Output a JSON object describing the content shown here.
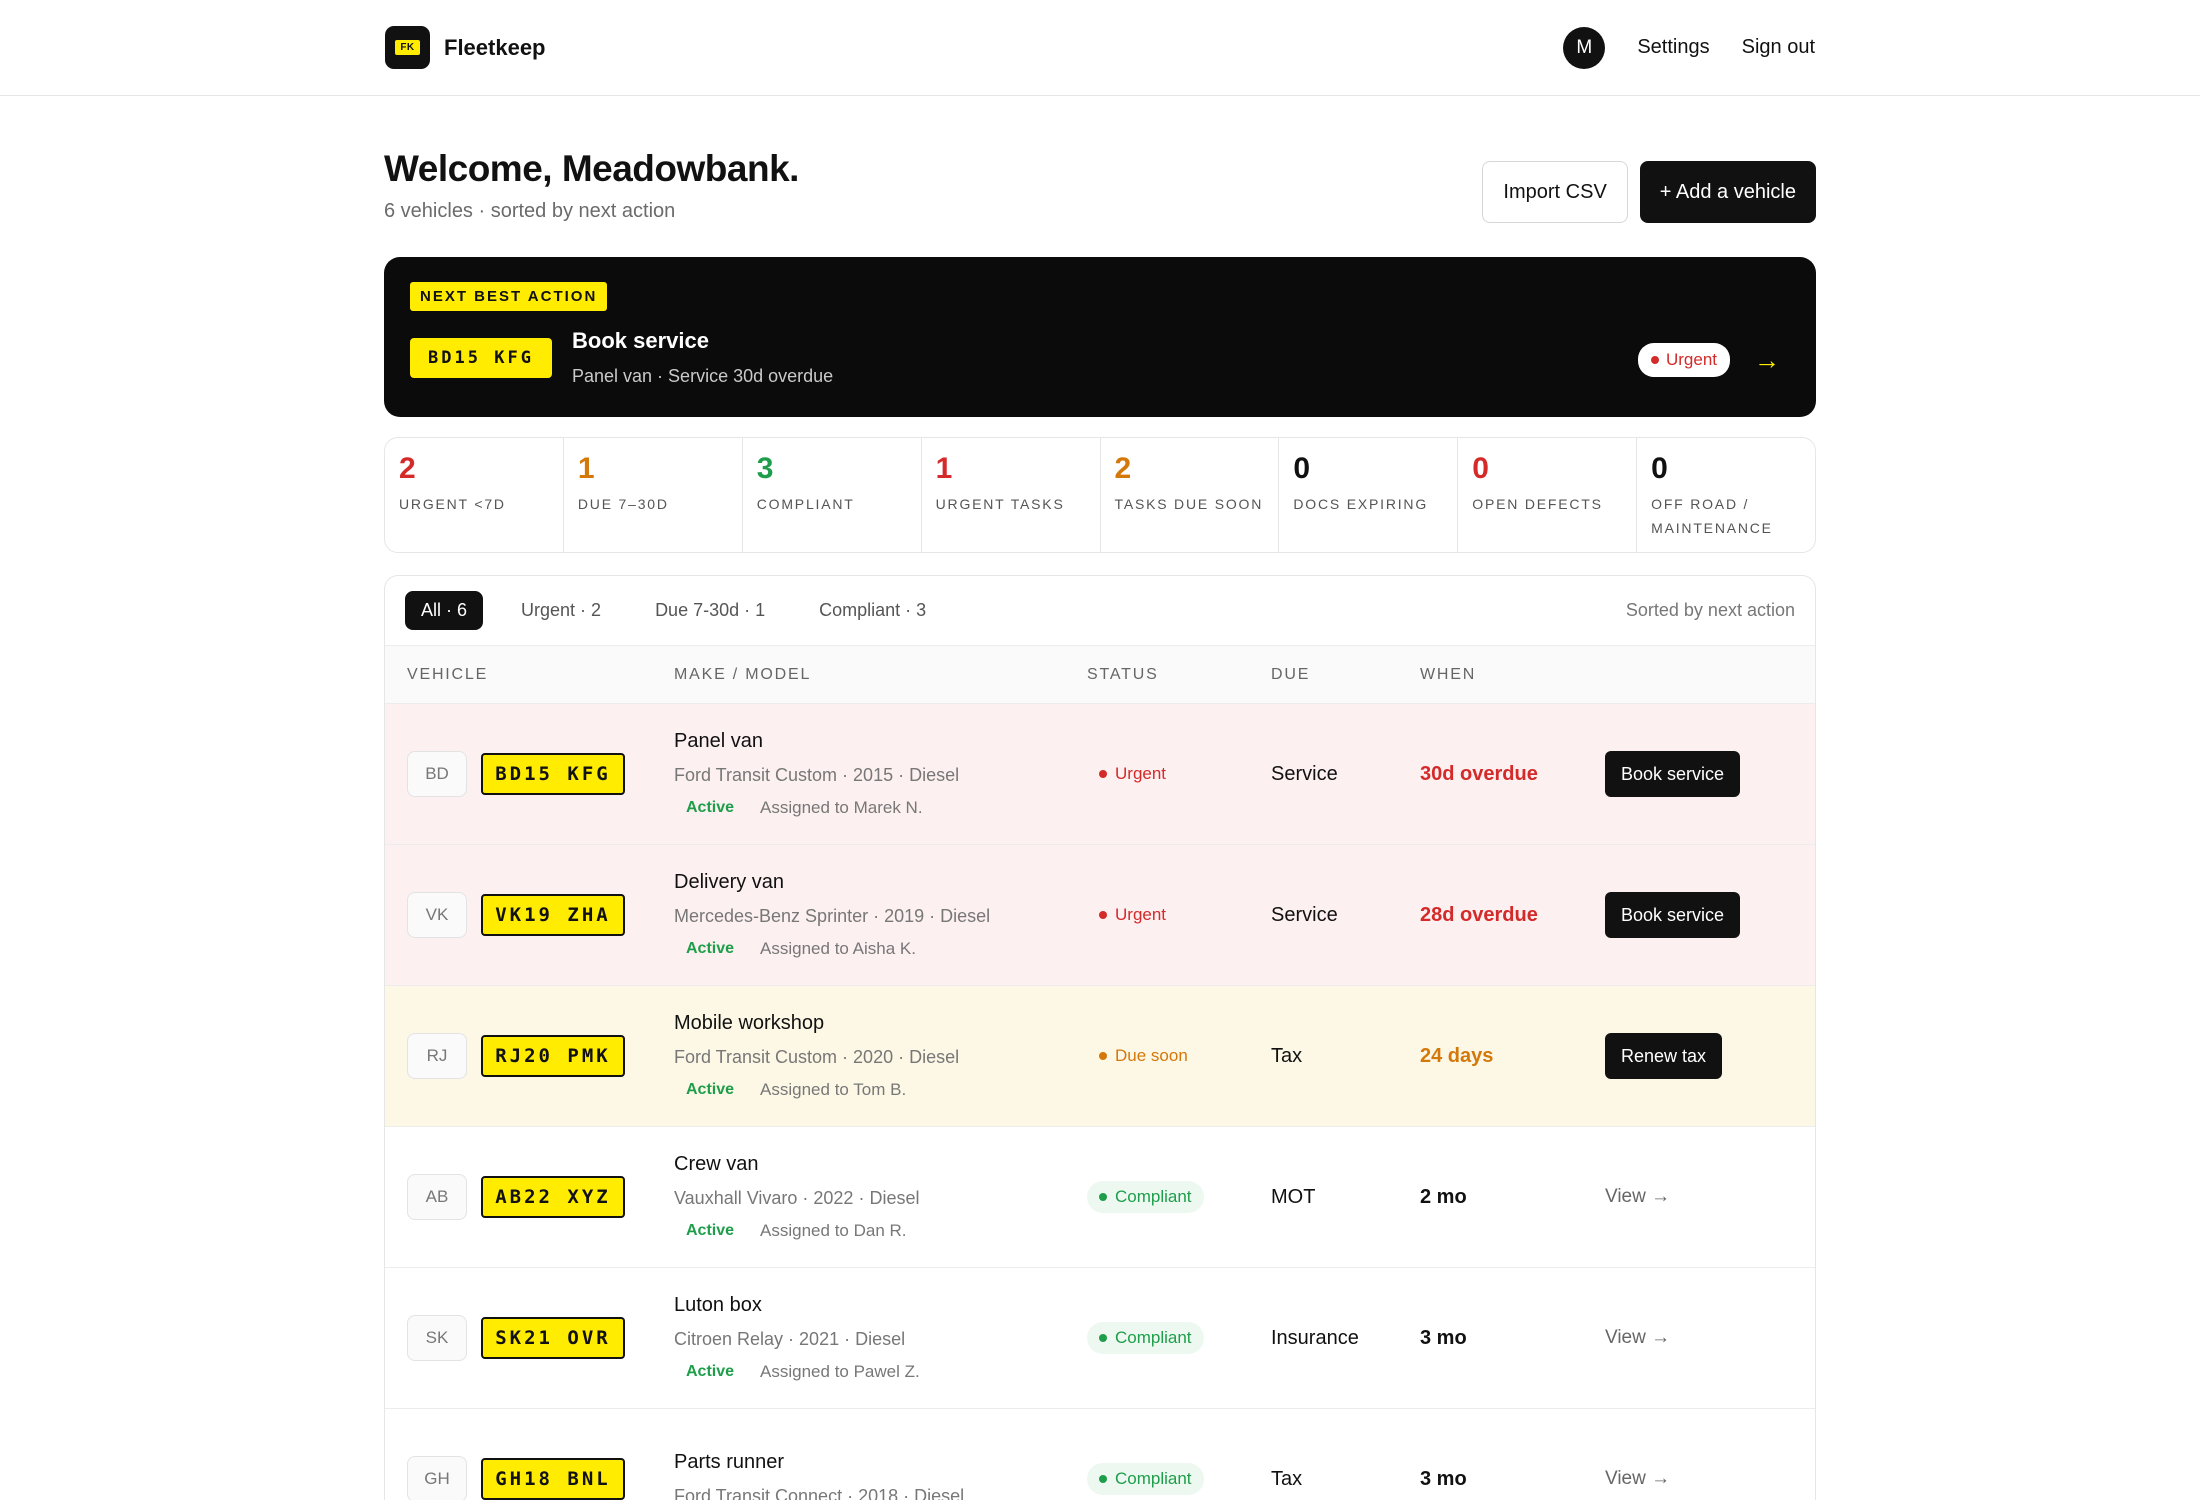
{
  "brand": {
    "logo_text": "FK",
    "name": "Fleetkeep"
  },
  "nav": {
    "avatar": "M",
    "settings": "Settings",
    "sign_out": "Sign out"
  },
  "page": {
    "title": "Welcome, Meadowbank.",
    "subtitle": "6 vehicles · sorted by next action"
  },
  "actions": {
    "import": "Import CSV",
    "add": "+ Add a vehicle"
  },
  "next_best_action": {
    "tag": "NEXT BEST ACTION",
    "plate": "BD15 KFG",
    "title": "Book service",
    "desc": "Panel van · Service 30d overdue",
    "status": "Urgent",
    "arrow": "→"
  },
  "stats": [
    {
      "value": "2",
      "label": "URGENT <7D",
      "color": "#d42a2a"
    },
    {
      "value": "1",
      "label": "DUE 7–30D",
      "color": "#d4780a"
    },
    {
      "value": "3",
      "label": "COMPLIANT",
      "color": "#1e9e4a"
    },
    {
      "value": "1",
      "label": "URGENT TASKS",
      "color": "#d42a2a"
    },
    {
      "value": "2",
      "label": "TASKS DUE SOON",
      "color": "#d4780a"
    },
    {
      "value": "0",
      "label": "DOCS EXPIRING",
      "color": "#111111"
    },
    {
      "value": "0",
      "label": "OPEN DEFECTS",
      "color": "#d42a2a"
    },
    {
      "value": "0",
      "label": "OFF ROAD / MAINTENANCE",
      "color": "#111111"
    }
  ],
  "filters": {
    "chips": [
      "All · 6",
      "Urgent · 2",
      "Due 7-30d · 1",
      "Compliant · 3"
    ],
    "sorted": "Sorted by next action"
  },
  "columns": {
    "vehicle": "VEHICLE",
    "make": "MAKE / MODEL",
    "status": "STATUS",
    "due": "DUE",
    "when": "WHEN"
  },
  "rows": [
    {
      "initials": "BD",
      "plate": "BD15 KFG",
      "name": "Panel van",
      "spec": "Ford Transit Custom · 2015 · Diesel",
      "active": "Active",
      "assigned": "Assigned to Marek N.",
      "status": "Urgent",
      "due": "Service",
      "when": "30d overdue",
      "action": "Book service"
    },
    {
      "initials": "VK",
      "plate": "VK19 ZHA",
      "name": "Delivery van",
      "spec": "Mercedes-Benz Sprinter · 2019 · Diesel",
      "active": "Active",
      "assigned": "Assigned to Aisha K.",
      "status": "Urgent",
      "due": "Service",
      "when": "28d overdue",
      "action": "Book service"
    },
    {
      "initials": "RJ",
      "plate": "RJ20 PMK",
      "name": "Mobile workshop",
      "spec": "Ford Transit Custom · 2020 · Diesel",
      "active": "Active",
      "assigned": "Assigned to Tom B.",
      "status": "Due soon",
      "due": "Tax",
      "when": "24 days",
      "action": "Renew tax"
    },
    {
      "initials": "AB",
      "plate": "AB22 XYZ",
      "name": "Crew van",
      "spec": "Vauxhall Vivaro · 2022 · Diesel",
      "active": "Active",
      "assigned": "Assigned to Dan R.",
      "status": "Compliant",
      "due": "MOT",
      "when": "2 mo",
      "action": "View →"
    },
    {
      "initials": "SK",
      "plate": "SK21 OVR",
      "name": "Luton box",
      "spec": "Citroen Relay · 2021 · Diesel",
      "active": "Active",
      "assigned": "Assigned to Pawel Z.",
      "status": "Compliant",
      "due": "Insurance",
      "when": "3 mo",
      "action": "View →"
    },
    {
      "initials": "GH",
      "plate": "GH18 BNL",
      "name": "Parts runner",
      "spec": "Ford Transit Connect · 2018 · Diesel",
      "status": "Compliant",
      "due": "Tax",
      "when": "3 mo",
      "action": "View →"
    }
  ],
  "colors": {
    "urgent": "#d42a2a",
    "soon": "#d4780a",
    "compliant": "#1e9e4a",
    "plate": "#ffec00"
  }
}
